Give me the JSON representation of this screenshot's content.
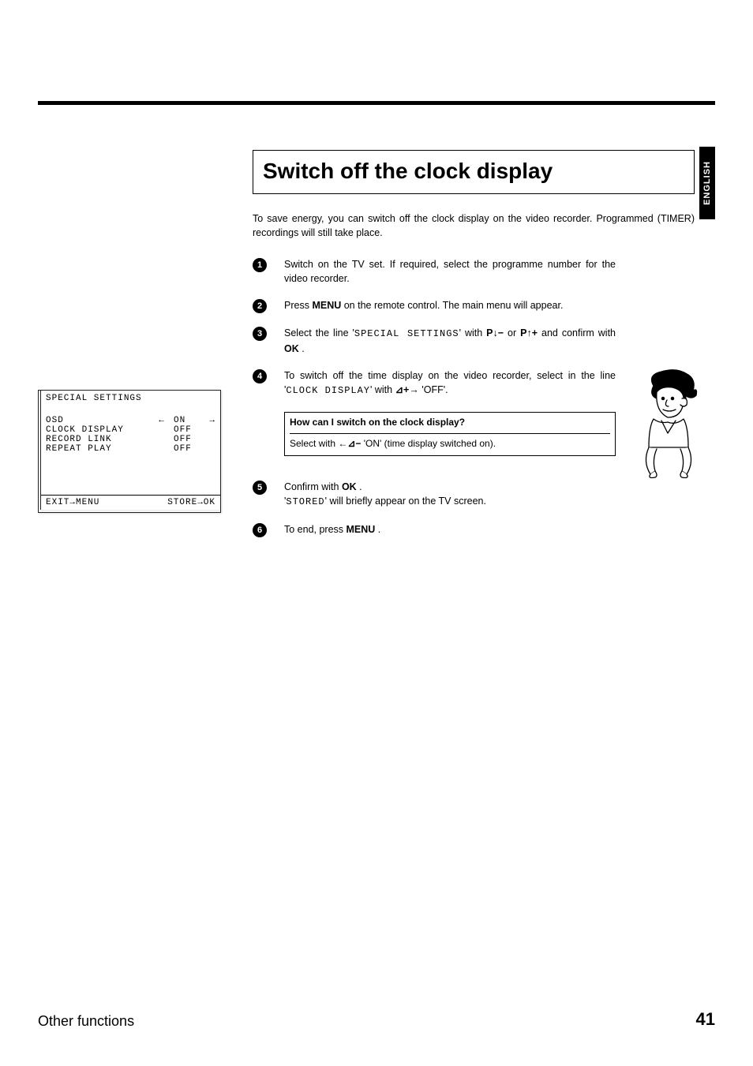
{
  "sideTab": "ENGLISH",
  "title": "Switch off the clock display",
  "intro": "To save energy, you can switch off the clock display on the video recorder. Programmed (TIMER) recordings will still take place.",
  "steps": {
    "s1": "Switch on the TV set. If required, select the programme number for the video recorder.",
    "s2_a": "Press ",
    "s2_btn": "MENU",
    "s2_b": " on the remote control. The main menu will appear.",
    "s3_a": "Select the line '",
    "s3_mono": "SPECIAL SETTINGS",
    "s3_b": "' with ",
    "s3_btn1": "P",
    "s3_sym1": "↓−",
    "s3_mid": " or ",
    "s3_btn2": "P",
    "s3_sym2": "↑+",
    "s3_c": " and confirm with ",
    "s3_ok": "OK",
    "s3_d": " .",
    "s4_a": "To switch off the time display on the video recorder, select in the line '",
    "s4_mono": "CLOCK DISPLAY",
    "s4_b": "' with ",
    "s4_sym": "⊿+→",
    "s4_c": " 'OFF'.",
    "note_q": "How can I switch on the clock display?",
    "note_a_a": "Select with ",
    "note_sym": "←⊿−",
    "note_a_b": " 'ON' (time display switched on).",
    "s5_a": "Confirm with ",
    "s5_ok": "OK",
    "s5_b": " .",
    "s5_line2_a": "'",
    "s5_line2_mono": "STORED",
    "s5_line2_b": "' will briefly appear on the TV screen.",
    "s6_a": "To end, press ",
    "s6_btn": "MENU",
    "s6_b": " ."
  },
  "screen": {
    "title": "SPECIAL SETTINGS",
    "rows": [
      {
        "label": "OSD",
        "arrowL": "←",
        "value": "ON",
        "arrowR": "→"
      },
      {
        "label": "CLOCK DISPLAY",
        "arrowL": "",
        "value": "OFF",
        "arrowR": ""
      },
      {
        "label": "RECORD LINK",
        "arrowL": "",
        "value": "OFF",
        "arrowR": ""
      },
      {
        "label": "REPEAT PLAY",
        "arrowL": "",
        "value": "OFF",
        "arrowR": ""
      }
    ],
    "footerLeft": "EXIT→MENU",
    "footerRight": "STORE→OK"
  },
  "footer": {
    "section": "Other functions",
    "page": "41"
  }
}
